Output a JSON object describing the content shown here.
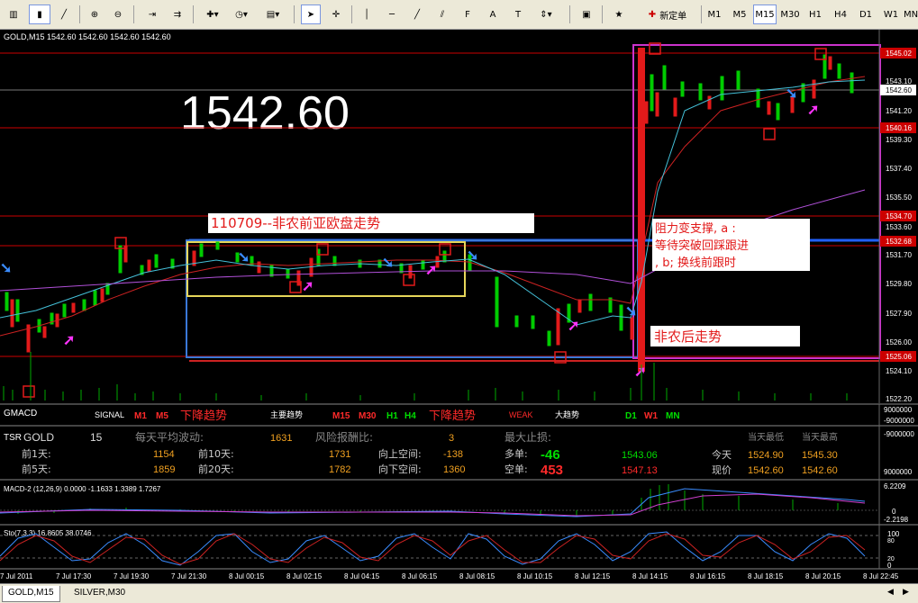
{
  "toolbar": {
    "new_order_label": "新定单",
    "timeframes": [
      "M1",
      "M5",
      "M15",
      "M30",
      "H1",
      "H4",
      "D1",
      "W1",
      "MN"
    ],
    "active_timeframe": "M15"
  },
  "chart": {
    "header": "GOLD,M15  1542.60 1542.60 1542.60 1542.60",
    "big_price": "1542.60",
    "price_labels": [
      "1545.02",
      "1543.10",
      "1542.60",
      "1541.20",
      "1540.16",
      "1539.30",
      "1537.40",
      "1535.50",
      "1534.70",
      "1533.60",
      "1532.68",
      "1531.70",
      "1529.80",
      "1527.90",
      "1526.00",
      "1525.06",
      "1524.10",
      "1522.20"
    ],
    "annotation_title": "110709--非农前亚欧盘走势",
    "annotation_right_lines": [
      "阻力变支撑, a :",
      "等待突破回踩跟进",
      ", b;  换线前跟时"
    ],
    "annotation_after": "非农后走势",
    "gmacd": {
      "label": "GMACD",
      "signal_label": "SIGNAL",
      "signal_m1": "M1",
      "signal_m5": "M5",
      "trend1": "下降趋势",
      "main_trend": "主要趋势",
      "m15": "M15",
      "m30": "M30",
      "h1": "H1",
      "h4": "H4",
      "trend2": "下降趋势",
      "weak": "WEAK",
      "big_trend": "大趋势",
      "d1": "D1",
      "w1": "W1",
      "mn": "MN",
      "scale_top": "9000000",
      "scale_bottom": "-9000000"
    },
    "tsr": {
      "title": "TSR",
      "symbol": "GOLD",
      "period": "15",
      "avg_label": "每天平均波动:",
      "avg_value": "1631",
      "risk_label": "风险报酬比:",
      "risk_value": "3",
      "stop_label": "最大止损:",
      "day_low_label": "当天最低",
      "day_high_label": "当天最高",
      "prev1_label": "前1天:",
      "prev1_value": "1154",
      "prev10_label": "前10天:",
      "prev10_value": "1731",
      "up_space_label": "向上空间:",
      "up_space_value": "-138",
      "long_label": "多单:",
      "long_value": "-46",
      "long_price": "1543.06",
      "today_label": "今天",
      "today_low": "1524.90",
      "today_high": "1545.30",
      "prev5_label": "前5天:",
      "prev5_value": "1859",
      "prev20_label": "前20天:",
      "prev20_value": "1782",
      "down_space_label": "向下空间:",
      "down_space_value": "1360",
      "short_label": "空单:",
      "short_value": "453",
      "short_price": "1547.13",
      "now_label": "现价",
      "now_low": "1542.60",
      "now_high": "1542.60",
      "scale_top": "-9000000",
      "scale_bottom": "9000000"
    },
    "macd": {
      "header": "MACD-2 (12,26,9) 0.0000 -1.1633 1.3389 1.7267",
      "scale_top": "6.2209",
      "scale_zero": "0",
      "scale_bottom": "-2.2198"
    },
    "sto": {
      "header": "Sto(7,3,3) 16.8605 38.0746",
      "scale_top": "100",
      "scale_80": "80",
      "scale_20": "20",
      "scale_0": "0"
    },
    "time_labels": [
      "7 Jul 2011",
      "7 Jul 17:30",
      "7 Jul 19:30",
      "7 Jul 21:30",
      "8 Jul 00:15",
      "8 Jul 02:15",
      "8 Jul 04:15",
      "8 Jul 06:15",
      "8 Jul 08:15",
      "8 Jul 10:15",
      "8 Jul 12:15",
      "8 Jul 14:15",
      "8 Jul 16:15",
      "8 Jul 18:15",
      "8 Jul 20:15",
      "8 Jul 22:45"
    ]
  },
  "tabs": [
    {
      "label": "GOLD,M15",
      "active": true
    },
    {
      "label": "SILVER,M30",
      "active": false
    }
  ]
}
